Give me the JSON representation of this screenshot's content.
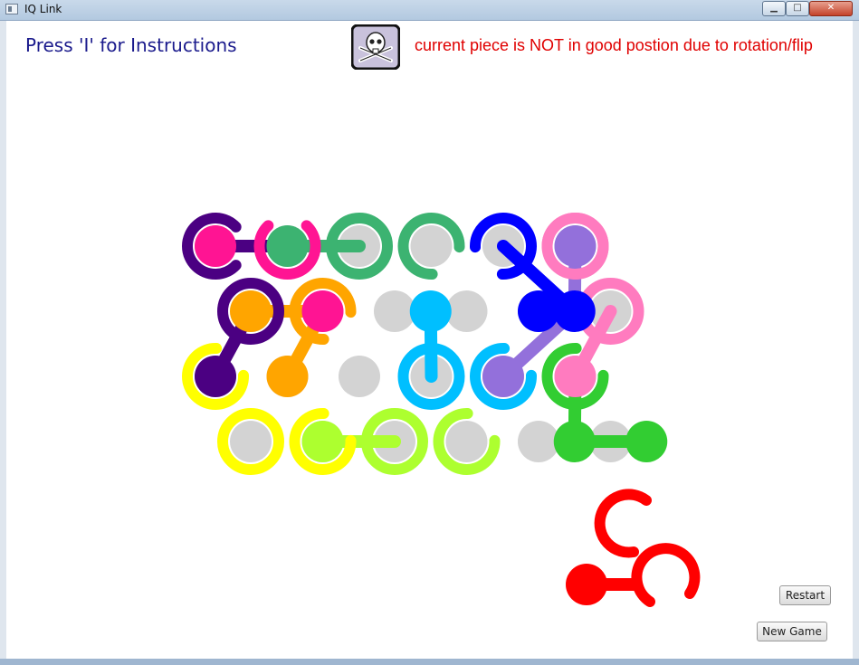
{
  "window": {
    "title": "IQ Link",
    "min_glyph": "▁",
    "max_glyph": "□",
    "close_glyph": "✕"
  },
  "header": {
    "instructions": "Press 'I' for Instructions",
    "status": "current piece is NOT in good postion due to rotation/flip",
    "status_icon": "skull-crossbones-icon"
  },
  "buttons": {
    "restart": "Restart",
    "new_game": "New Game"
  },
  "colors": {
    "grey": "#d3d3d3",
    "purple": "#4b0082",
    "magenta": "#ff1493",
    "sea": "#3cb371",
    "blue": "#0000ff",
    "pink": "#ff7bbf",
    "lavender": "#9370db",
    "orange": "#ffa500",
    "cyan": "#00bfff",
    "yellow": "#ffff00",
    "lime": "#adff2f",
    "green": "#32cd32",
    "red": "#ff0000"
  },
  "board": {
    "holes": [
      [
        0,
        0
      ],
      [
        1,
        0
      ],
      [
        2,
        0
      ],
      [
        3,
        0
      ],
      [
        4,
        0
      ],
      [
        5,
        0
      ],
      [
        0,
        1
      ],
      [
        1,
        1
      ],
      [
        2,
        1
      ],
      [
        3,
        1
      ],
      [
        4,
        1
      ],
      [
        5,
        1
      ],
      [
        0,
        2
      ],
      [
        1,
        2
      ],
      [
        2,
        2
      ],
      [
        3,
        2
      ],
      [
        4,
        2
      ],
      [
        5,
        2
      ],
      [
        0,
        3
      ],
      [
        1,
        3
      ],
      [
        2,
        3
      ],
      [
        3,
        3
      ],
      [
        4,
        3
      ],
      [
        5,
        3
      ]
    ],
    "empty_rings": [
      {
        "col": 2,
        "row": 0,
        "color": "sea",
        "open": "none"
      },
      {
        "col": 3,
        "row": 0,
        "color": "sea",
        "open": "se"
      },
      {
        "col": 4,
        "row": 0,
        "color": "blue",
        "open": "sw"
      },
      {
        "col": 5,
        "row": 0,
        "color": "pink",
        "open": "sw"
      },
      {
        "col": 5,
        "row": 1,
        "color": "pink",
        "open": "none"
      },
      {
        "col": 3,
        "row": 2,
        "color": "cyan",
        "open": "none"
      },
      {
        "col": 0,
        "row": 3,
        "color": "yellow",
        "open": "none"
      },
      {
        "col": 2,
        "row": 3,
        "color": "lime",
        "open": "none"
      },
      {
        "col": 3,
        "row": 3,
        "color": "lime",
        "open": "ne"
      }
    ],
    "filled_rings": [
      {
        "col": 0,
        "row": 0,
        "color": "purple",
        "ball": "magenta",
        "open": "e"
      },
      {
        "col": 1,
        "row": 0,
        "color": "magenta",
        "ball": "sea",
        "open": "n"
      },
      {
        "col": 0,
        "row": 1,
        "color": "purple",
        "ball": "orange",
        "open": "none"
      },
      {
        "col": 1,
        "row": 1,
        "color": "orange",
        "ball": "magenta",
        "open": "se"
      },
      {
        "col": 4,
        "row": 2,
        "color": "cyan",
        "ball": "lavender",
        "open": "ne"
      },
      {
        "col": 5,
        "row": 0,
        "color": "pink",
        "ball": "lavender",
        "open": "none"
      },
      {
        "col": 5,
        "row": 2,
        "color": "green",
        "ball": "pink",
        "open": "ne"
      },
      {
        "col": 0,
        "row": 2,
        "color": "yellow",
        "ball": "purple",
        "open": "ne"
      },
      {
        "col": 1,
        "row": 3,
        "color": "yellow",
        "ball": "lime",
        "open": "ne"
      }
    ],
    "balls": [
      {
        "col": 2.5,
        "row": 1,
        "color": "cyan"
      },
      {
        "col": 4,
        "row": 1,
        "color": "blue"
      },
      {
        "col": 4.5,
        "row": 1,
        "color": "blue"
      },
      {
        "col": 1,
        "row": 2,
        "color": "orange"
      },
      {
        "col": 5.5,
        "row": 3,
        "color": "green"
      },
      {
        "col": 4.5,
        "row": 3,
        "color": "green"
      }
    ],
    "connectors": [
      {
        "from": [
          0,
          0
        ],
        "to": [
          1,
          0
        ],
        "color": "purple"
      },
      {
        "from": [
          1,
          0
        ],
        "to": [
          2,
          0
        ],
        "color": "sea"
      },
      {
        "from": [
          0,
          1
        ],
        "to": [
          0,
          2
        ],
        "color": "purple"
      },
      {
        "from": [
          0,
          1
        ],
        "to": [
          1,
          1
        ],
        "color": "orange"
      },
      {
        "from": [
          1,
          1
        ],
        "to": [
          1,
          2
        ],
        "color": "orange"
      },
      {
        "from": [
          2.5,
          1
        ],
        "to": [
          3,
          2
        ],
        "color": "cyan"
      },
      {
        "from": [
          4,
          1
        ],
        "to": [
          4.5,
          1
        ],
        "color": "blue"
      },
      {
        "from": [
          4,
          0
        ],
        "to": [
          4.5,
          1
        ],
        "color": "blue"
      },
      {
        "from": [
          5,
          0
        ],
        "to": [
          4.5,
          1
        ],
        "color": "lavender"
      },
      {
        "from": [
          4.5,
          1
        ],
        "to": [
          4,
          2
        ],
        "color": "lavender"
      },
      {
        "from": [
          5,
          1
        ],
        "to": [
          5,
          2
        ],
        "color": "pink"
      },
      {
        "from": [
          5,
          2
        ],
        "to": [
          4.5,
          3
        ],
        "color": "green"
      },
      {
        "from": [
          4.5,
          3
        ],
        "to": [
          5.5,
          3
        ],
        "color": "green"
      },
      {
        "from": [
          1,
          3
        ],
        "to": [
          2,
          3
        ],
        "color": "lime"
      }
    ]
  },
  "current_piece": {
    "color": "red",
    "rings": 2,
    "balls": 1
  }
}
